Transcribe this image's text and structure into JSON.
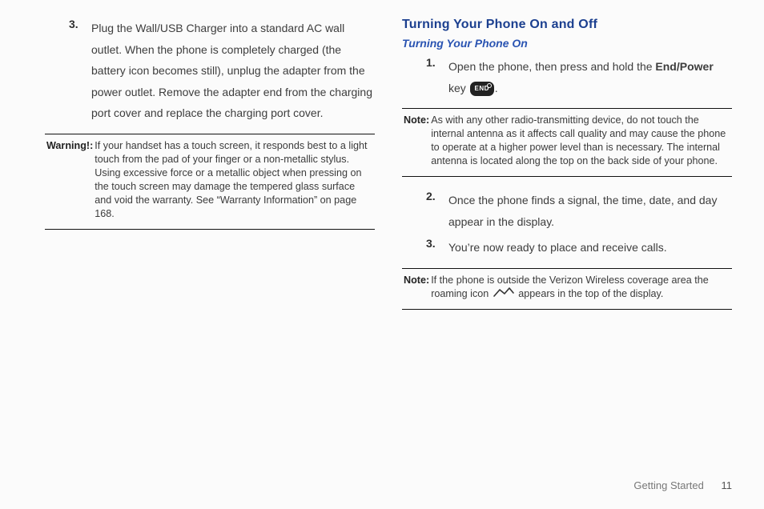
{
  "left": {
    "step3_num": "3.",
    "step3_txt": "Plug the Wall/USB Charger into a standard AC wall outlet. When the phone is completely charged (the battery icon becomes still), unplug the adapter from the power outlet. Remove the adapter end from the charging port cover and replace the charging port cover.",
    "warning_label": "Warning!:",
    "warning_txt": "If your handset has a touch screen, it responds best to a light touch from the pad of your finger or a non-metallic stylus. Using excessive force or a metallic object when pressing on the touch screen may damage the tempered glass surface and void the warranty. See “Warranty Information” on page 168."
  },
  "right": {
    "h1": "Turning Your Phone On and Off",
    "h2": "Turning Your Phone On",
    "step1_num": "1.",
    "step1_pre": "Open the phone, then press and hold the ",
    "step1_bold": "End/Power",
    "step1_post_a": " key ",
    "step1_post_b": ".",
    "end_key_label": "END",
    "note1_label": "Note:",
    "note1_txt": "As with any other radio-transmitting device, do not touch the internal antenna as it affects call quality and may cause the phone to operate at a higher power level than is necessary. The internal antenna is located along the top on the back side of your phone.",
    "step2_num": "2.",
    "step2_txt": "Once the phone finds a signal, the time, date, and day appear in the display.",
    "step3_num": "3.",
    "step3_txt": "You’re now ready to place and receive calls.",
    "note2_label": "Note:",
    "note2_txt_a": "If the phone is outside the Verizon Wireless coverage area the roaming icon ",
    "note2_txt_b": " appears in the top of the display."
  },
  "footer": {
    "section": "Getting Started",
    "page": "11"
  }
}
